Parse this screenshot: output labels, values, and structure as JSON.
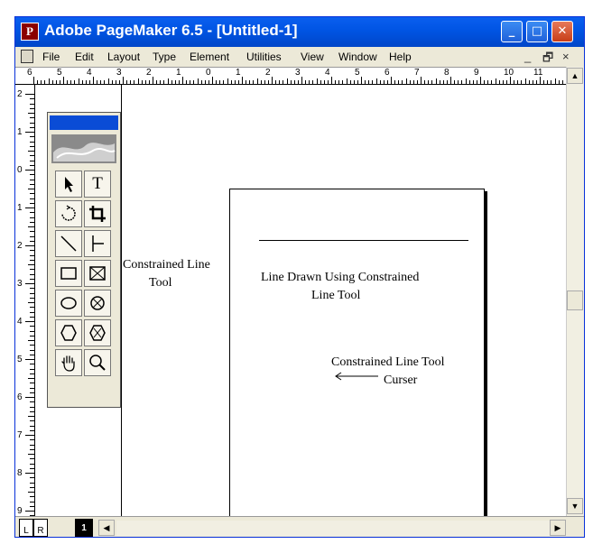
{
  "window": {
    "title": "Adobe PageMaker 6.5 - [Untitled-1]",
    "app_icon_letter": "P",
    "controls": {
      "minimize": "_",
      "maximize": "□",
      "close": "✕"
    }
  },
  "menu": {
    "items": [
      "File",
      "Edit",
      "Layout",
      "Type",
      "Element",
      "Utilities",
      "View",
      "Window",
      "Help"
    ],
    "mdi": {
      "minimize": "_",
      "restore": "🗗",
      "close": "×"
    }
  },
  "rulers": {
    "horizontal": [
      "6",
      "5",
      "4",
      "3",
      "2",
      "1",
      "0",
      "1",
      "2",
      "3",
      "4",
      "5",
      "6",
      "7",
      "8",
      "9",
      "10",
      "11"
    ],
    "vertical": [
      "2",
      "1",
      "0",
      "1",
      "2",
      "3",
      "4",
      "5",
      "6",
      "7",
      "8",
      "9"
    ]
  },
  "canvas": {
    "constrained_tool_label_line1": "Constrained Line",
    "constrained_tool_label_line2": "Tool",
    "line_caption_line1": "Line Drawn Using Constrained",
    "line_caption_line2": "Line Tool",
    "cursor_caption_line1": "Constrained Line Tool",
    "cursor_caption_line2": "Curser"
  },
  "toolbox": {
    "tools": [
      "pointer",
      "text",
      "rotate",
      "crop",
      "constrained-line",
      "line",
      "rectangle",
      "rectangle-frame",
      "ellipse",
      "ellipse-frame",
      "polygon",
      "polygon-frame",
      "hand",
      "zoom"
    ],
    "text_tool_glyph": "T"
  },
  "pages": {
    "left": "L",
    "right": "R",
    "current": "1"
  },
  "scrollbar": {
    "up": "▲",
    "down": "▼",
    "left": "◀",
    "right": "▶"
  }
}
